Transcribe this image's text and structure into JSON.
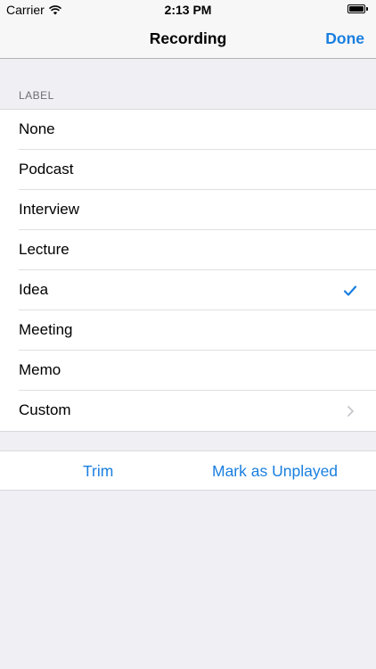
{
  "status_bar": {
    "carrier": "Carrier",
    "time": "2:13 PM",
    "wifi_icon": "wifi-icon",
    "battery_icon": "battery-full-icon"
  },
  "nav": {
    "title": "Recording",
    "done_label": "Done"
  },
  "colors": {
    "accent": "#1a7fe0",
    "background": "#efeff4",
    "separator": "#e0e0e4",
    "secondary_text": "#6d6d72"
  },
  "section": {
    "header": "LABEL"
  },
  "label_options": [
    {
      "label": "None"
    },
    {
      "label": "Podcast"
    },
    {
      "label": "Interview"
    },
    {
      "label": "Lecture"
    },
    {
      "label": "Idea",
      "selected": true,
      "accessory_icon": "checkmark-icon"
    },
    {
      "label": "Meeting"
    },
    {
      "label": "Memo"
    },
    {
      "label": "Custom",
      "accessory_icon": "chevron-right-icon"
    }
  ],
  "actions": {
    "trim_label": "Trim",
    "unplayed_label": "Mark as Unplayed"
  }
}
